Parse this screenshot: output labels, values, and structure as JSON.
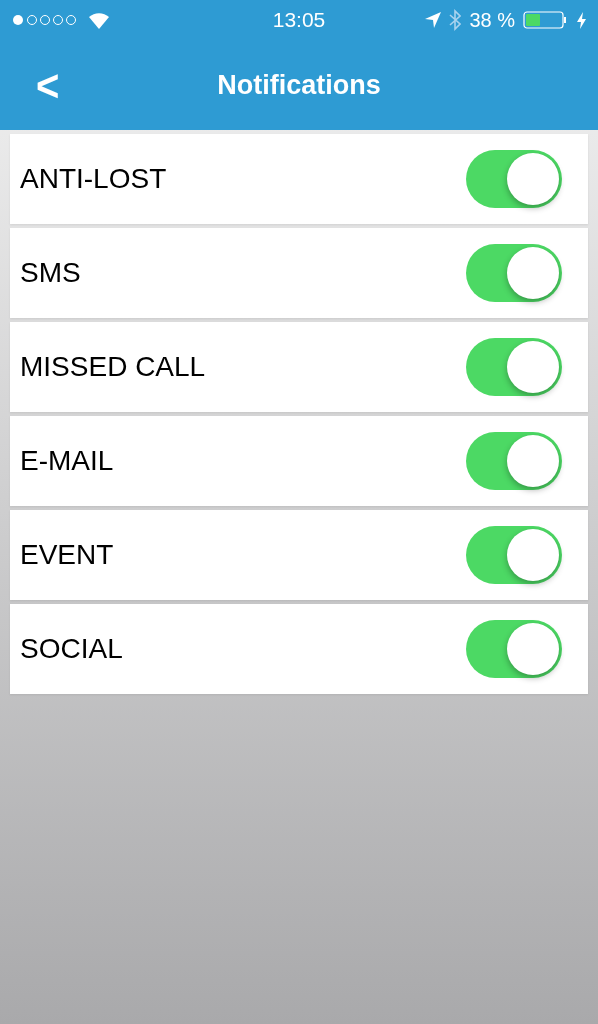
{
  "status_bar": {
    "time": "13:05",
    "battery": "38 %"
  },
  "nav": {
    "back": "<",
    "title": "Notifications"
  },
  "settings": [
    {
      "label": "ANTI-LOST",
      "on": true
    },
    {
      "label": "SMS",
      "on": true
    },
    {
      "label": "MISSED CALL",
      "on": true
    },
    {
      "label": "E-MAIL",
      "on": true
    },
    {
      "label": "EVENT",
      "on": true
    },
    {
      "label": "SOCIAL",
      "on": true
    }
  ]
}
